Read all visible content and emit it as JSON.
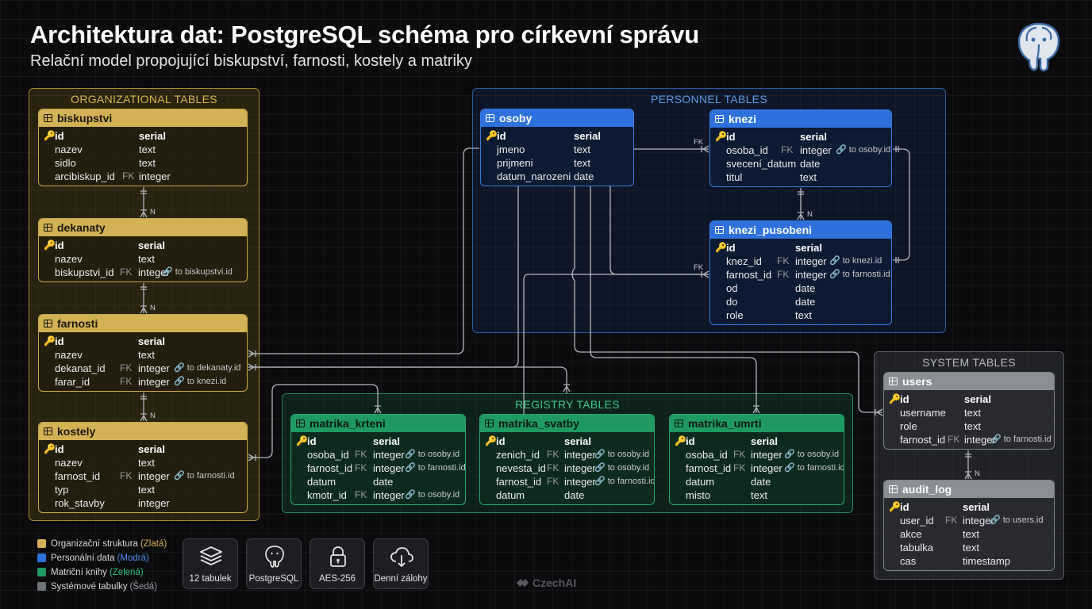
{
  "title": "Architektura dat: PostgreSQL schéma pro církevní správu",
  "subtitle": "Relační model propojující biskupství, farnosti, kostely a matriky",
  "logo_icon": "postgresql-elephant-icon",
  "groups": {
    "organizational": "ORGANIZATIONAL TABLES",
    "personnel": "PERSONNEL TABLES",
    "registry": "REGISTRY TABLES",
    "system": "SYSTEM TABLES"
  },
  "tables": {
    "biskupstvi": {
      "name": "biskupstvi",
      "rows": [
        {
          "key": "🔑",
          "name": "id",
          "fk": "",
          "type": "serial",
          "ref": ""
        },
        {
          "key": "",
          "name": "nazev",
          "fk": "",
          "type": "text",
          "ref": ""
        },
        {
          "key": "",
          "name": "sidlo",
          "fk": "",
          "type": "text",
          "ref": ""
        },
        {
          "key": "",
          "name": "arcibiskup_id",
          "fk": "FK",
          "type": "integer",
          "ref": ""
        }
      ]
    },
    "dekanaty": {
      "name": "dekanaty",
      "rows": [
        {
          "key": "🔑",
          "name": "id",
          "fk": "",
          "type": "serial",
          "ref": ""
        },
        {
          "key": "",
          "name": "nazev",
          "fk": "",
          "type": "text",
          "ref": ""
        },
        {
          "key": "",
          "name": "biskupstvi_id",
          "fk": "FK",
          "type": "integer",
          "ref": "🔗 to biskupstvi.id"
        }
      ]
    },
    "farnosti": {
      "name": "farnosti",
      "rows": [
        {
          "key": "🔑",
          "name": "id",
          "fk": "",
          "type": "serial",
          "ref": ""
        },
        {
          "key": "",
          "name": "nazev",
          "fk": "",
          "type": "text",
          "ref": ""
        },
        {
          "key": "",
          "name": "dekanat_id",
          "fk": "FK",
          "type": "integer",
          "ref": "🔗 to dekanaty.id"
        },
        {
          "key": "",
          "name": "farar_id",
          "fk": "FK",
          "type": "integer",
          "ref": "🔗 to knezi.id"
        }
      ]
    },
    "kostely": {
      "name": "kostely",
      "rows": [
        {
          "key": "🔑",
          "name": "id",
          "fk": "",
          "type": "serial",
          "ref": ""
        },
        {
          "key": "",
          "name": "nazev",
          "fk": "",
          "type": "text",
          "ref": ""
        },
        {
          "key": "",
          "name": "farnost_id",
          "fk": "FK",
          "type": "integer",
          "ref": "🔗 to farnosti.id"
        },
        {
          "key": "",
          "name": "typ",
          "fk": "",
          "type": "text",
          "ref": ""
        },
        {
          "key": "",
          "name": "rok_stavby",
          "fk": "",
          "type": "integer",
          "ref": ""
        }
      ]
    },
    "osoby": {
      "name": "osoby",
      "rows": [
        {
          "key": "🔑",
          "name": "id",
          "fk": "",
          "type": "serial",
          "ref": ""
        },
        {
          "key": "",
          "name": "jmeno",
          "fk": "",
          "type": "text",
          "ref": ""
        },
        {
          "key": "",
          "name": "prijmeni",
          "fk": "",
          "type": "text",
          "ref": ""
        },
        {
          "key": "",
          "name": "datum_narozeni",
          "fk": "",
          "type": "date",
          "ref": ""
        }
      ]
    },
    "knezi": {
      "name": "knezi",
      "rows": [
        {
          "key": "🔑",
          "name": "id",
          "fk": "",
          "type": "serial",
          "ref": ""
        },
        {
          "key": "",
          "name": "osoba_id",
          "fk": "FK",
          "type": "integer",
          "ref": "🔗 to osoby.id"
        },
        {
          "key": "",
          "name": "svecení_datum",
          "fk": "",
          "type": "date",
          "ref": ""
        },
        {
          "key": "",
          "name": "titul",
          "fk": "",
          "type": "text",
          "ref": ""
        }
      ]
    },
    "knezi_pusobeni": {
      "name": "knezi_pusobeni",
      "rows": [
        {
          "key": "🔑",
          "name": "id",
          "fk": "",
          "type": "serial",
          "ref": ""
        },
        {
          "key": "",
          "name": "knez_id",
          "fk": "FK",
          "type": "integer",
          "ref": "🔗 to knezi.id"
        },
        {
          "key": "",
          "name": "farnost_id",
          "fk": "FK",
          "type": "integer",
          "ref": "🔗 to farnosti.id"
        },
        {
          "key": "",
          "name": "od",
          "fk": "",
          "type": "date",
          "ref": ""
        },
        {
          "key": "",
          "name": "do",
          "fk": "",
          "type": "date",
          "ref": ""
        },
        {
          "key": "",
          "name": "role",
          "fk": "",
          "type": "text",
          "ref": ""
        }
      ]
    },
    "matrika_krteni": {
      "name": "matrika_krteni",
      "rows": [
        {
          "key": "🔑",
          "name": "id",
          "fk": "",
          "type": "serial",
          "ref": ""
        },
        {
          "key": "",
          "name": "osoba_id",
          "fk": "FK",
          "type": "integer",
          "ref": "🔗 to osoby.id"
        },
        {
          "key": "",
          "name": "farnost_id",
          "fk": "FK",
          "type": "integer",
          "ref": "🔗 to farnosti.id"
        },
        {
          "key": "",
          "name": "datum",
          "fk": "",
          "type": "date",
          "ref": ""
        },
        {
          "key": "",
          "name": "kmotr_id",
          "fk": "FK",
          "type": "integer",
          "ref": "🔗 to osoby.id"
        }
      ]
    },
    "matrika_svatby": {
      "name": "matrika_svatby",
      "rows": [
        {
          "key": "🔑",
          "name": "id",
          "fk": "",
          "type": "serial",
          "ref": ""
        },
        {
          "key": "",
          "name": "zenich_id",
          "fk": "FK",
          "type": "integer",
          "ref": "🔗 to osoby.id"
        },
        {
          "key": "",
          "name": "nevesta_id",
          "fk": "FK",
          "type": "integer",
          "ref": "🔗 to osoby.id"
        },
        {
          "key": "",
          "name": "farnost_id",
          "fk": "FK",
          "type": "integer",
          "ref": "🔗 to farnosti.id"
        },
        {
          "key": "",
          "name": "datum",
          "fk": "",
          "type": "date",
          "ref": ""
        }
      ]
    },
    "matrika_umrti": {
      "name": "matrika_umrti",
      "rows": [
        {
          "key": "🔑",
          "name": "id",
          "fk": "",
          "type": "serial",
          "ref": ""
        },
        {
          "key": "",
          "name": "osoba_id",
          "fk": "FK",
          "type": "integer",
          "ref": "🔗 to osoby.id"
        },
        {
          "key": "",
          "name": "farnost_id",
          "fk": "FK",
          "type": "integer",
          "ref": "🔗 to farnosti.id"
        },
        {
          "key": "",
          "name": "datum",
          "fk": "",
          "type": "date",
          "ref": ""
        },
        {
          "key": "",
          "name": "misto",
          "fk": "",
          "type": "text",
          "ref": ""
        }
      ]
    },
    "users": {
      "name": "users",
      "rows": [
        {
          "key": "🔑",
          "name": "id",
          "fk": "",
          "type": "serial",
          "ref": ""
        },
        {
          "key": "",
          "name": "username",
          "fk": "",
          "type": "text",
          "ref": ""
        },
        {
          "key": "",
          "name": "role",
          "fk": "",
          "type": "text",
          "ref": ""
        },
        {
          "key": "",
          "name": "farnost_id",
          "fk": "FK",
          "type": "integer",
          "ref": "🔗 to farnosti.id"
        }
      ]
    },
    "audit_log": {
      "name": "audit_log",
      "rows": [
        {
          "key": "🔑",
          "name": "id",
          "fk": "",
          "type": "serial",
          "ref": ""
        },
        {
          "key": "",
          "name": "user_id",
          "fk": "FK",
          "type": "integer",
          "ref": "🔗 to users.id"
        },
        {
          "key": "",
          "name": "akce",
          "fk": "",
          "type": "text",
          "ref": ""
        },
        {
          "key": "",
          "name": "tabulka",
          "fk": "",
          "type": "text",
          "ref": ""
        },
        {
          "key": "",
          "name": "cas",
          "fk": "",
          "type": "timestamp",
          "ref": ""
        }
      ]
    }
  },
  "relation_labels": {
    "n": "N",
    "fk": "FK"
  },
  "legend": [
    {
      "label": "Organizační struktura",
      "hint": "(Zlatá)",
      "color": "#d3b155"
    },
    {
      "label": "Personální data",
      "hint": "(Modrá)",
      "color": "#2e71dc"
    },
    {
      "label": "Matriční knihy",
      "hint": "(Zelená)",
      "color": "#1f9a62"
    },
    {
      "label": "Systémové tabulky",
      "hint": "(Šedá)",
      "color": "#6f7379"
    }
  ],
  "badges": [
    {
      "label": "12 tabulek",
      "icon": "layers-icon"
    },
    {
      "label": "PostgreSQL",
      "icon": "postgresql-icon"
    },
    {
      "label": "AES-256",
      "icon": "lock-icon"
    },
    {
      "label": "Denní zálohy",
      "icon": "cloud-backup-icon"
    }
  ],
  "watermark": "CzechAI"
}
